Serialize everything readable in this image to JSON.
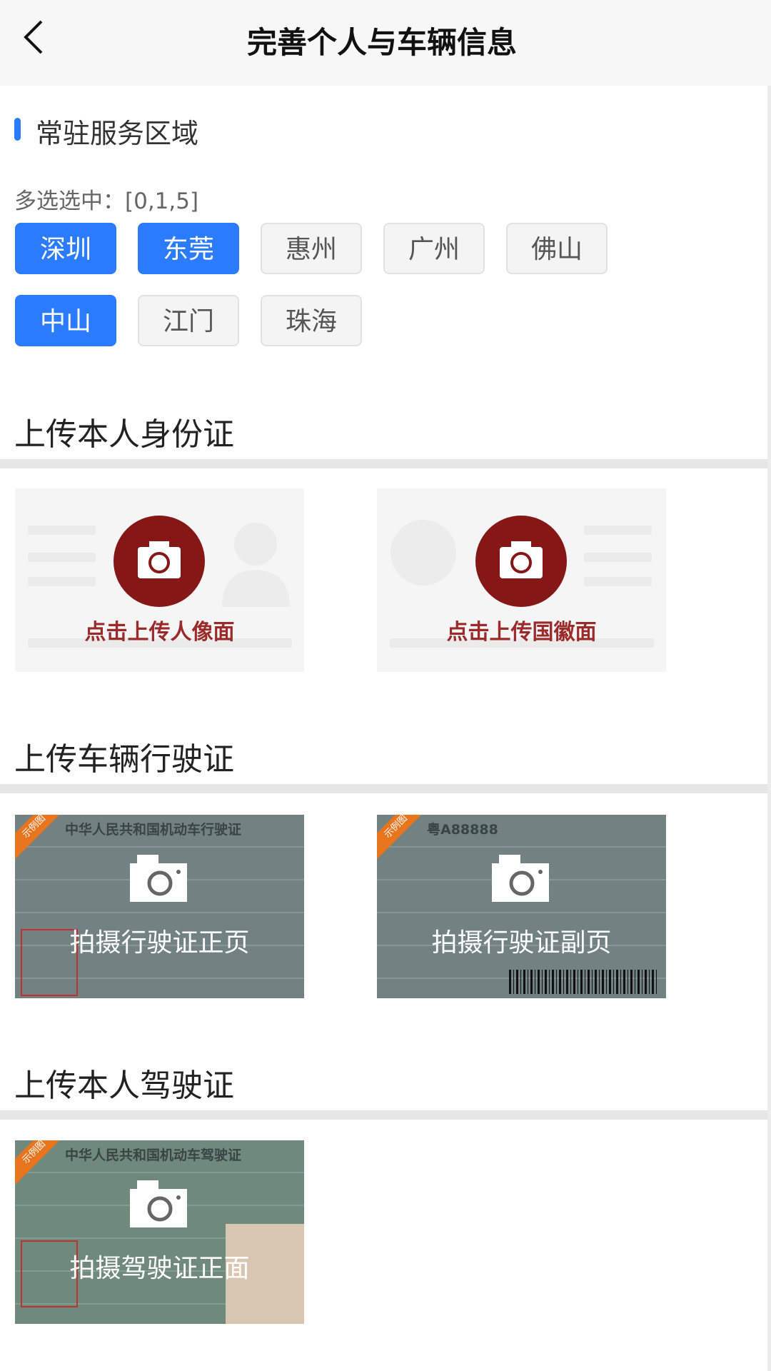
{
  "header": {
    "title": "完善个人与车辆信息",
    "back_icon": "chevron-left-icon"
  },
  "region": {
    "title": "常驻服务区域",
    "selected_text": "多选选中：[0,1,5]",
    "selected": [
      0,
      1,
      5
    ],
    "options": [
      "深圳",
      "东莞",
      "惠州",
      "广州",
      "佛山",
      "中山",
      "江门",
      "珠海"
    ],
    "accent": "#2b7bff"
  },
  "id_card": {
    "title": "上传本人身份证",
    "front_label": "点击上传人像面",
    "back_label": "点击上传国徽面",
    "icon": "camera-icon",
    "icon_color": "#861717"
  },
  "vehicle_license": {
    "title": "上传车辆行驶证",
    "front_label": "拍摄行驶证正页",
    "back_label": "拍摄行驶证副页",
    "sample_badge": "示例图",
    "front_doc_title": "中华人民共和国机动车行驶证",
    "back_doc_plate": "粤A88888"
  },
  "driver_license": {
    "title": "上传本人驾驶证",
    "front_label": "拍摄驾驶证正面",
    "sample_badge": "示例图",
    "doc_title": "中华人民共和国机动车驾驶证"
  }
}
